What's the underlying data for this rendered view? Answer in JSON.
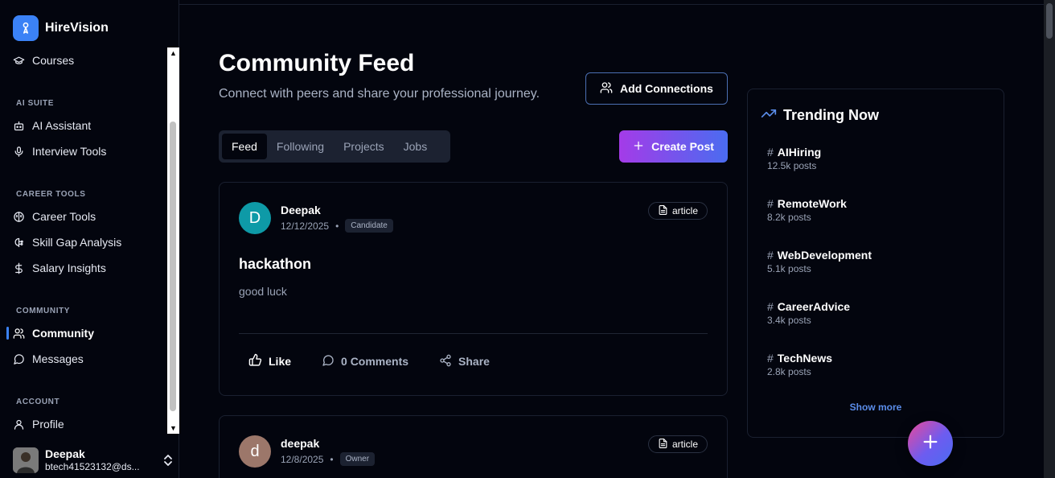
{
  "brand": {
    "name": "HireVision",
    "logo_icon": "user-pin-icon",
    "color": "#3b82f6"
  },
  "sidebar": {
    "sections": [
      {
        "label": "AI SUITE"
      },
      {
        "label": "CAREER TOOLS"
      },
      {
        "label": "COMMUNITY"
      },
      {
        "label": "ACCOUNT"
      }
    ],
    "items": [
      {
        "label": "Courses",
        "icon": "graduation-cap-icon"
      },
      {
        "label": "AI Assistant",
        "icon": "bot-icon"
      },
      {
        "label": "Interview Tools",
        "icon": "mic-icon"
      },
      {
        "label": "Career Tools",
        "icon": "brain-icon"
      },
      {
        "label": "Skill Gap Analysis",
        "icon": "brain-circuit-icon"
      },
      {
        "label": "Salary Insights",
        "icon": "dollar-icon"
      },
      {
        "label": "Community",
        "icon": "users-icon",
        "active": true
      },
      {
        "label": "Messages",
        "icon": "message-circle-icon"
      },
      {
        "label": "Profile",
        "icon": "user-icon"
      }
    ],
    "user": {
      "name": "Deepak",
      "email": "btech41523132@ds..."
    }
  },
  "main": {
    "title": "Community Feed",
    "subtitle": "Connect with peers and share your professional journey.",
    "add_connections_label": "Add Connections",
    "create_post_label": "Create Post",
    "tabs": [
      {
        "label": "Feed",
        "active": true
      },
      {
        "label": "Following"
      },
      {
        "label": "Projects"
      },
      {
        "label": "Jobs"
      }
    ]
  },
  "posts": [
    {
      "initial": "D",
      "avatar_color": "#0e9aa7",
      "author": "Deepak",
      "date": "12/12/2025",
      "role": "Candidate",
      "type": "article",
      "title": "hackathon",
      "body": "good luck",
      "like_label": "Like",
      "comments_label": "0 Comments",
      "share_label": "Share"
    },
    {
      "initial": "d",
      "avatar_color": "#9c776a",
      "author": "deepak",
      "date": "12/8/2025",
      "role": "Owner",
      "type": "article"
    }
  ],
  "trending": {
    "title": "Trending Now",
    "items": [
      {
        "tag": "AIHiring",
        "count": "12.5k posts"
      },
      {
        "tag": "RemoteWork",
        "count": "8.2k posts"
      },
      {
        "tag": "WebDevelopment",
        "count": "5.1k posts"
      },
      {
        "tag": "CareerAdvice",
        "count": "3.4k posts"
      },
      {
        "tag": "TechNews",
        "count": "2.8k posts"
      }
    ],
    "show_more_label": "Show more"
  },
  "colors": {
    "accent": "#3b82f6",
    "create_gradient_start": "#a43be8",
    "create_gradient_end": "#4a6cf0"
  }
}
